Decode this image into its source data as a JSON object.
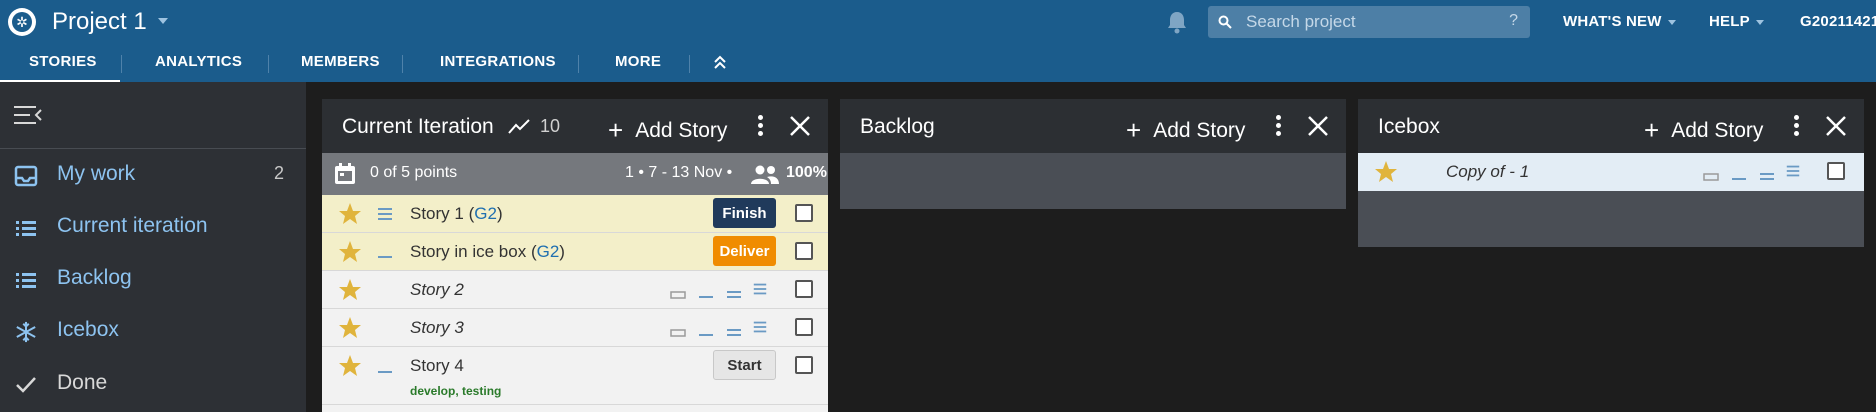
{
  "header": {
    "project_title": "Project 1",
    "search_placeholder": "Search project",
    "search_help": "?",
    "whats_new": "WHAT'S NEW",
    "help": "HELP",
    "user": "G20211421"
  },
  "tabs": [
    "STORIES",
    "ANALYTICS",
    "MEMBERS",
    "INTEGRATIONS",
    "MORE"
  ],
  "sidebar": {
    "items": [
      {
        "label": "My work",
        "count": "2",
        "icon": "inbox-icon"
      },
      {
        "label": "Current iteration",
        "icon": "list-icon"
      },
      {
        "label": "Backlog",
        "icon": "list-icon"
      },
      {
        "label": "Icebox",
        "icon": "snowflake-icon"
      },
      {
        "label": "Done",
        "icon": "checkmark-icon"
      }
    ]
  },
  "current": {
    "title": "Current Iteration",
    "velocity": "10",
    "add_story": "Add Story",
    "points": "0 of 5 points",
    "iteration": "1 • 7 - 13 Nov •",
    "team_strength": "100%",
    "stories": [
      {
        "title": "Story 1 (",
        "tag": "G2",
        "close": ")",
        "button": "Finish"
      },
      {
        "title": "Story in ice box (",
        "tag": "G2",
        "close": ")",
        "button": "Deliver"
      },
      {
        "title": "Story 2"
      },
      {
        "title": "Story 3"
      },
      {
        "title": "Story 4",
        "button": "Start",
        "labels": "develop, testing"
      }
    ]
  },
  "backlog": {
    "title": "Backlog",
    "add_story": "Add Story"
  },
  "icebox": {
    "title": "Icebox",
    "add_story": "Add Story",
    "stories": [
      {
        "title": "Copy of - 1"
      }
    ]
  },
  "colors": {
    "topbar": "#1b5c8c",
    "sidebar": "#2d3035",
    "accent_text": "#8dc3f0",
    "finish": "#203a5b",
    "deliver": "#f08c00",
    "star": "#e0b43c"
  }
}
